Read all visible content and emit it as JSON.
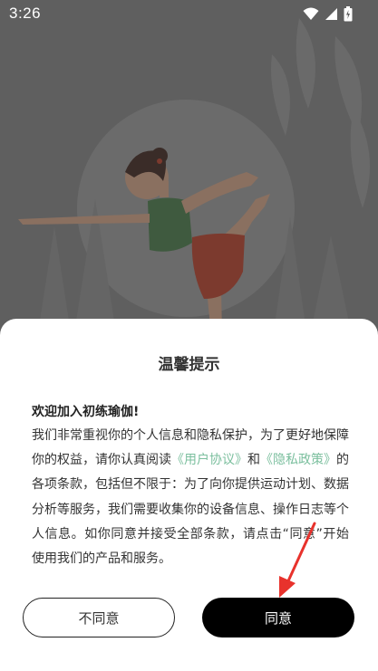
{
  "status_bar": {
    "time": "3:26"
  },
  "dialog": {
    "title": "温馨提示",
    "welcome": "欢迎加入初练瑜伽!",
    "body_intro": "我们非常重视你的个人信息和隐私保护，为了更好地保障你的权益，请你认真阅读",
    "user_agreement_link": "《用户协议》",
    "and": "和",
    "privacy_policy_link": "《隐私政策》",
    "body_rest": "的各项条款，包括但不限于：为了向你提供运动计划、数据分析等服务，我们需要收集你的设备信息、操作日志等个人信息。如你同意并接受全部条款，请点击“同意”开始使用我们的产品和服务。",
    "disagree_label": "不同意",
    "agree_label": "同意"
  },
  "colors": {
    "link": "#7bbf9e",
    "agree_bg": "#000000",
    "annotation_arrow": "#e8322c"
  }
}
